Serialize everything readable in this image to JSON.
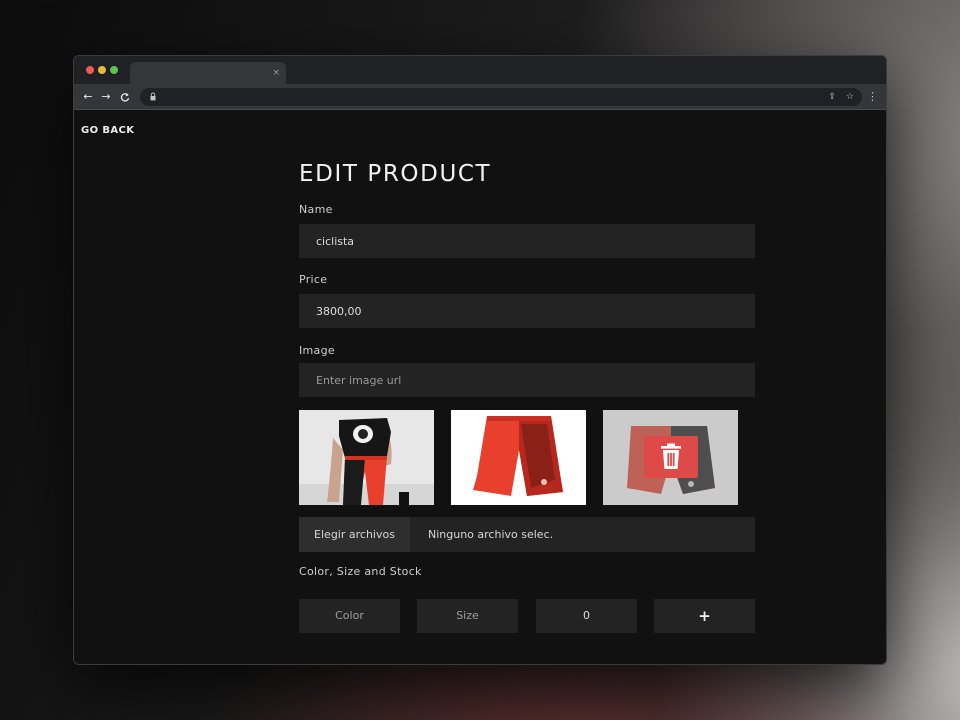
{
  "browser": {
    "tab_close": "×",
    "nav": {
      "back": "←",
      "forward": "→",
      "reload": "C"
    },
    "omnibox_icons": {
      "share": "⇪",
      "bookmark": "☆"
    },
    "menu": "⋮"
  },
  "page": {
    "go_back": "GO BACK",
    "title": "EDIT PRODUCT"
  },
  "form": {
    "name": {
      "label": "Name",
      "value": "ciclista"
    },
    "price": {
      "label": "Price",
      "value": "3800,00"
    },
    "image": {
      "label": "Image",
      "placeholder": "Enter image url"
    },
    "images": [
      {
        "icon": "product-photo-model"
      },
      {
        "icon": "product-photo-shorts"
      },
      {
        "icon": "product-photo-shorts-hover-delete"
      }
    ],
    "file": {
      "button": "Elegir archivos",
      "status": "Ninguno archivo selec."
    },
    "variants": {
      "label": "Color, Size and Stock",
      "color_placeholder": "Color",
      "size_placeholder": "Size",
      "stock_value": "0",
      "add_label": "+"
    }
  },
  "colors": {
    "background": "#111111",
    "field": "#232323",
    "delete_accent": "#dd4a48",
    "product_red": "#e8402c"
  }
}
